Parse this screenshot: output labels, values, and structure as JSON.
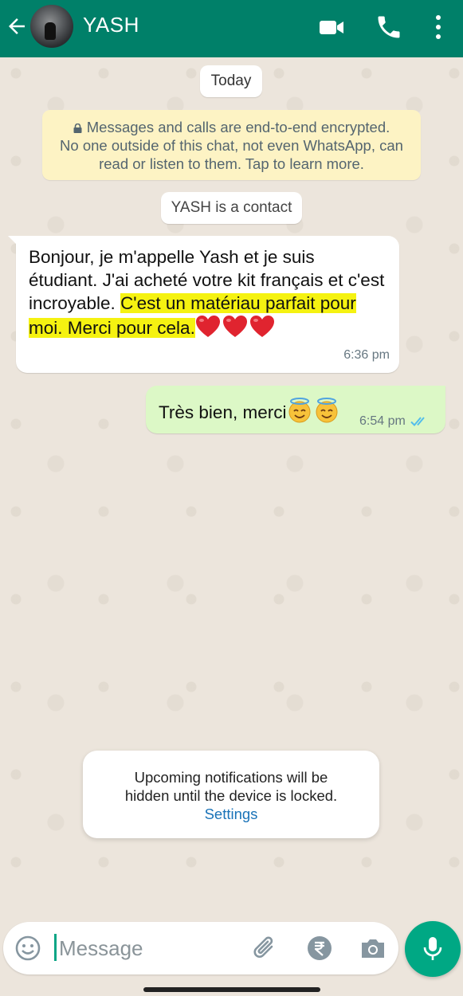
{
  "header": {
    "contact_name": "YASH",
    "back_icon": "arrow-left-icon",
    "video_icon": "video-call-icon",
    "call_icon": "phone-icon",
    "menu_icon": "more-vertical-icon",
    "color": "#008069"
  },
  "chat": {
    "date_chip": "Today",
    "encryption_notice": {
      "line1": "Messages and calls are end-to-end encrypted.",
      "line2": "No one outside of this chat, not even WhatsApp, can",
      "line3": "read or listen to them. Tap to learn more.",
      "icon": "lock-icon"
    },
    "contact_chip": "YASH is a contact",
    "messages": [
      {
        "direction": "incoming",
        "text_plain": "Bonjour, je m'appelle Yash et je suis étudiant. J'ai acheté votre kit français et c'est incroyable. ",
        "text_highlighted": "C'est un matériau parfait pour moi. Merci pour cela.",
        "emojis": "❤️❤️❤️",
        "time": "6:36 pm"
      },
      {
        "direction": "outgoing",
        "text": "Très bien, merci",
        "emojis": "😇😇",
        "time": "6:54 pm",
        "status": "read",
        "status_icon": "double-check-icon"
      }
    ]
  },
  "toast": {
    "line1": "Upcoming notifications will be",
    "line2": "hidden until the device is locked.",
    "link": "Settings"
  },
  "composer": {
    "placeholder": "Message",
    "emoji_icon": "emoji-icon",
    "attach_icon": "paperclip-icon",
    "payment_icon": "rupee-icon",
    "camera_icon": "camera-icon",
    "mic_icon": "microphone-icon",
    "accent": "#00a884"
  }
}
